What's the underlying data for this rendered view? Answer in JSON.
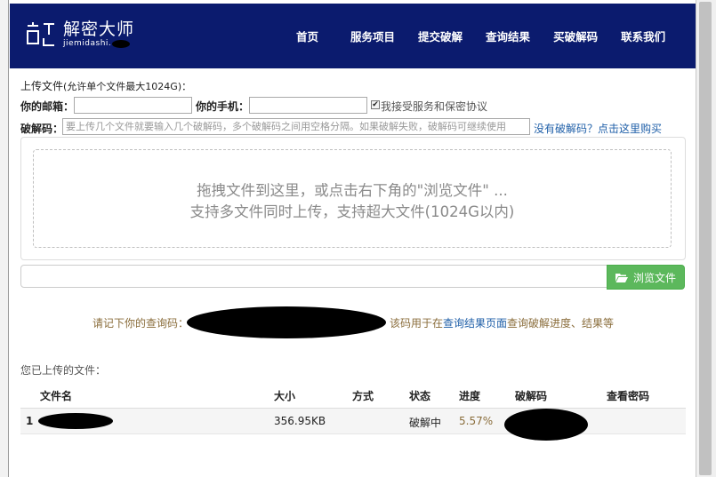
{
  "header": {
    "logo_cn": "解密大师",
    "logo_en": "jiemidashi.",
    "nav": [
      "首页",
      "服务项目",
      "提交破解",
      "查询结果",
      "买破解码",
      "联系我们"
    ]
  },
  "form": {
    "upload_title": "上传文件",
    "upload_hint": "(允许单个文件最大1024G)：",
    "email_label": "你的邮箱：",
    "email_value": "",
    "phone_label": "你的手机：",
    "phone_value": "",
    "agree_text": "我接受服务和保密协议",
    "agree_checked": true,
    "code_label": "破解码：",
    "code_placeholder": "要上传几个文件就要输入几个破解码，多个破解码之间用空格分隔。如果破解失败，破解码可继续使用",
    "buy_link_prefix": "没有破解码？",
    "buy_link": "点击这里购买"
  },
  "dropzone": {
    "line1": "拖拽文件到这里，或点击右下角的\"浏览文件\" ...",
    "line2": "支持多文件同时上传，支持超大文件(1024G以内)"
  },
  "browse_button": "浏览文件",
  "notice": {
    "prefix": "请记下你的查询码：",
    "middle": "该码用于在",
    "link": "查询结果页面",
    "suffix": "查询破解进度、结果等"
  },
  "uploaded": {
    "title": "您已上传的文件：",
    "columns": [
      "文件名",
      "大小",
      "方式",
      "状态",
      "进度",
      "破解码",
      "查看密码"
    ],
    "rows": [
      {
        "index": "1",
        "filename": "",
        "size": "356.95KB",
        "method": "",
        "status": "破解中",
        "progress": "5.57%",
        "code": "",
        "password": ""
      }
    ]
  },
  "colors": {
    "header_bg": "#0b1b6e",
    "button_green": "#5cb85c",
    "notice_brown": "#8a6d3b",
    "link_blue": "#1f5fa8"
  }
}
